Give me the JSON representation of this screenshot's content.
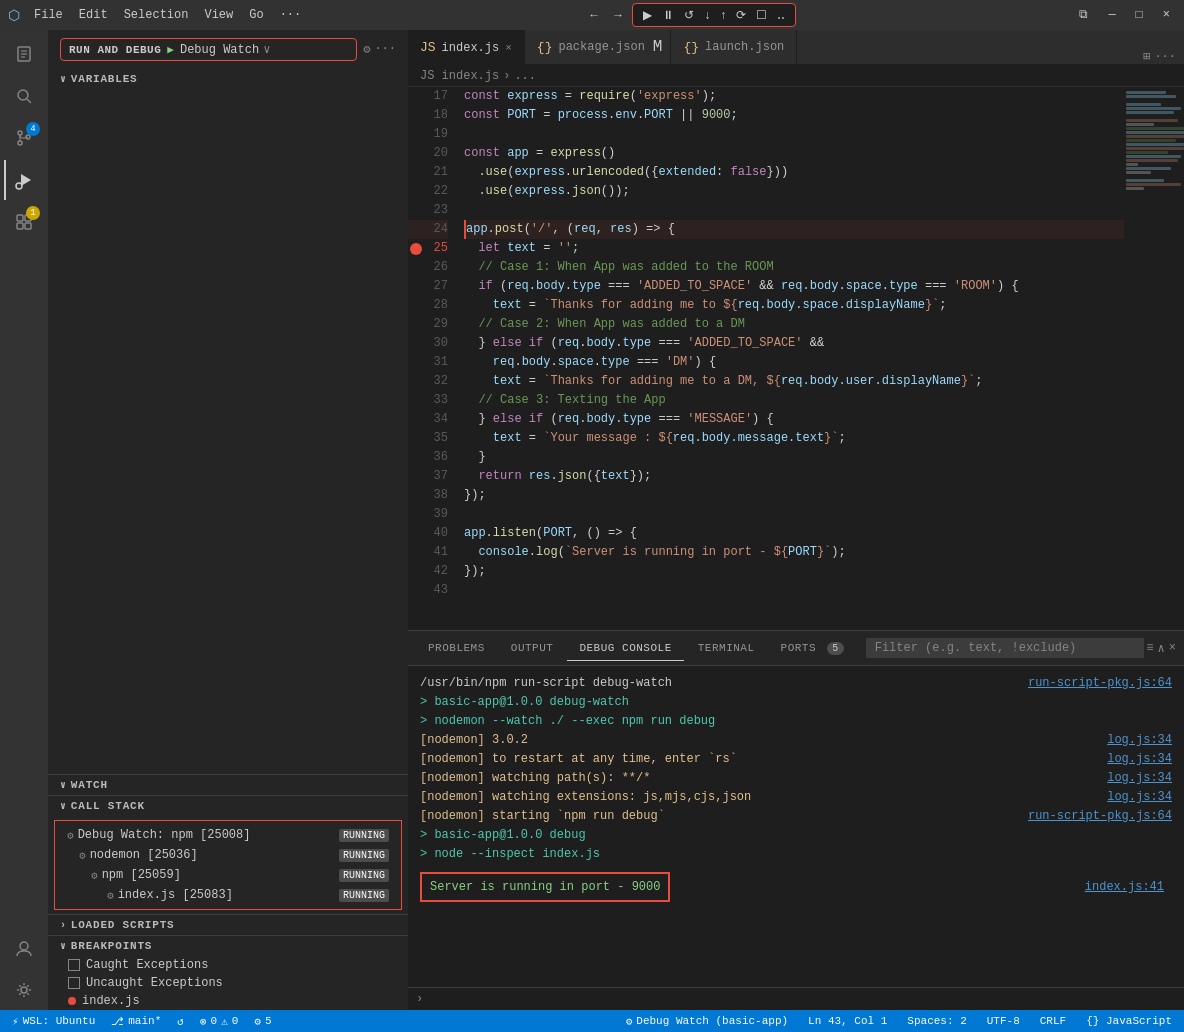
{
  "titlebar": {
    "icon": "⬡",
    "menus": [
      "File",
      "Edit",
      "Selection",
      "View",
      "Go",
      "···"
    ],
    "back_label": "←",
    "forward_label": "→",
    "debug_buttons": [
      "▶",
      "⏸",
      "↺",
      "↓",
      "↑",
      "⟳",
      "☐",
      "‥"
    ],
    "controls": [
      "⧉",
      "▭",
      "❐",
      "─",
      "□",
      "×"
    ]
  },
  "sidebar": {
    "run_debug_label": "RUN AND DEBUG",
    "debug_config": "Debug Watch",
    "sections": {
      "variables": "VARIABLES",
      "watch": "WATCH",
      "call_stack": "CALL STACK",
      "loaded_scripts": "LOADED SCRIPTS",
      "breakpoints": "BREAKPOINTS"
    },
    "call_stack": {
      "items": [
        {
          "label": "Debug Watch: npm [25008]",
          "indent": 0,
          "status": "RUNNING"
        },
        {
          "label": "nodemon [25036]",
          "indent": 1,
          "status": "RUNNING"
        },
        {
          "label": "npm [25059]",
          "indent": 2,
          "status": "RUNNING"
        },
        {
          "label": "index.js [25083]",
          "indent": 3,
          "status": "RUNNING"
        }
      ]
    },
    "breakpoints": {
      "items": [
        {
          "type": "checkbox",
          "label": "Caught Exceptions",
          "checked": false
        },
        {
          "type": "checkbox",
          "label": "Uncaught Exceptions",
          "checked": false
        },
        {
          "type": "file",
          "label": "index.js",
          "line": "",
          "color": "red"
        }
      ]
    }
  },
  "activity_bar": {
    "icons": [
      {
        "name": "explorer-icon",
        "symbol": "⎘",
        "active": false
      },
      {
        "name": "search-icon",
        "symbol": "🔍",
        "active": false
      },
      {
        "name": "source-control-icon",
        "symbol": "⎇",
        "active": false,
        "badge": "4"
      },
      {
        "name": "run-debug-icon",
        "symbol": "▶",
        "active": true
      },
      {
        "name": "extensions-icon",
        "symbol": "⊞",
        "active": false,
        "badge_yellow": "1"
      },
      {
        "name": "remote-icon",
        "symbol": "⊞",
        "active": false
      }
    ]
  },
  "tabs": [
    {
      "label": "index.js",
      "type": "js",
      "active": true,
      "modified": false,
      "icon": "JS"
    },
    {
      "label": "package.json",
      "type": "json",
      "active": false,
      "modified": true,
      "icon": "{}"
    },
    {
      "label": "launch.json",
      "type": "json",
      "active": false,
      "modified": false,
      "icon": "{}"
    }
  ],
  "breadcrumb": {
    "parts": [
      "index.js",
      ">",
      "..."
    ]
  },
  "code": {
    "lines": [
      {
        "num": 17,
        "content": "const express = require('express');"
      },
      {
        "num": 18,
        "content": "const PORT = process.env.PORT || 9000;"
      },
      {
        "num": 19,
        "content": ""
      },
      {
        "num": 20,
        "content": "const app = express()"
      },
      {
        "num": 21,
        "content": "  .use(express.urlencoded({extended: false}))"
      },
      {
        "num": 22,
        "content": "  .use(express.json());"
      },
      {
        "num": 23,
        "content": ""
      },
      {
        "num": 24,
        "content": "app.post('/', (req, res) => {",
        "highlighted": true
      },
      {
        "num": 25,
        "content": "  let text = '';",
        "breakpoint": true
      },
      {
        "num": 26,
        "content": "  // Case 1: When App was added to the ROOM"
      },
      {
        "num": 27,
        "content": "  if (req.body.type === 'ADDED_TO_SPACE' && req.body.space.type === 'ROOM') {"
      },
      {
        "num": 28,
        "content": "    text = `Thanks for adding me to ${req.body.space.displayName}`;"
      },
      {
        "num": 29,
        "content": "  // Case 2: When App was added to a DM"
      },
      {
        "num": 30,
        "content": "  } else if (req.body.type === 'ADDED_TO_SPACE' &&"
      },
      {
        "num": 31,
        "content": "    req.body.space.type === 'DM') {"
      },
      {
        "num": 32,
        "content": "    text = `Thanks for adding me to a DM, ${req.body.user.displayName}`;"
      },
      {
        "num": 33,
        "content": "  // Case 3: Texting the App"
      },
      {
        "num": 34,
        "content": "  } else if (req.body.type === 'MESSAGE') {"
      },
      {
        "num": 35,
        "content": "    text = `Your message : ${req.body.message.text}`;"
      },
      {
        "num": 36,
        "content": "  }"
      },
      {
        "num": 37,
        "content": "  return res.json({text});"
      },
      {
        "num": 38,
        "content": "});"
      },
      {
        "num": 39,
        "content": ""
      },
      {
        "num": 40,
        "content": "app.listen(PORT, () => {"
      },
      {
        "num": 41,
        "content": "  console.log(`Server is running in port - ${PORT}`);"
      },
      {
        "num": 42,
        "content": "});"
      },
      {
        "num": 43,
        "content": ""
      }
    ]
  },
  "panel": {
    "tabs": [
      "PROBLEMS",
      "OUTPUT",
      "DEBUG CONSOLE",
      "TERMINAL",
      "PORTS"
    ],
    "ports_count": "5",
    "active_tab": "DEBUG CONSOLE",
    "filter_placeholder": "Filter (e.g. text, !exclude)",
    "console_lines": [
      {
        "text": "/usr/bin/npm run-script debug-watch",
        "color": "normal",
        "link": "run-script-pkg.js:64"
      },
      {
        "text": "",
        "color": "normal"
      },
      {
        "text": "> basic-app@1.0.0 debug-watch",
        "color": "green"
      },
      {
        "text": "> nodemon --watch ./ --exec npm run debug",
        "color": "green"
      },
      {
        "text": "",
        "color": "normal"
      },
      {
        "text": "[nodemon] 3.0.2",
        "color": "yellow"
      },
      {
        "text": "[nodemon] to restart at any time, enter `rs`",
        "color": "yellow",
        "link": "log.js:34"
      },
      {
        "text": "[nodemon] watching path(s): **/*",
        "color": "yellow",
        "link": "log.js:34"
      },
      {
        "text": "[nodemon] watching extensions: js,mjs,cjs,json",
        "color": "yellow",
        "link": "log.js:34"
      },
      {
        "text": "[nodemon] starting `npm run debug`",
        "color": "yellow",
        "link": "log.js:34"
      },
      {
        "text": "",
        "color": "normal"
      },
      {
        "text": "> basic-app@1.0.0 debug",
        "color": "green"
      },
      {
        "text": "> node --inspect index.js",
        "color": "green"
      },
      {
        "text": "",
        "color": "normal"
      },
      {
        "text": "Server is running in port - 9000",
        "color": "highlight",
        "link": "index.js:41"
      }
    ]
  },
  "statusbar": {
    "wsl": "⚡ WSL: Ubuntu",
    "branch": " main*",
    "sync": "↺",
    "errors": "⊗ 0",
    "warnings": "⚠ 0",
    "debug": "⚙ 5",
    "debug_watch": "⚙ Debug Watch (basic-app)",
    "position": "Ln 43, Col 1",
    "spaces": "Spaces: 2",
    "encoding": "UTF-8",
    "line_ending": "CRLF",
    "language": "{} JavaScript"
  }
}
